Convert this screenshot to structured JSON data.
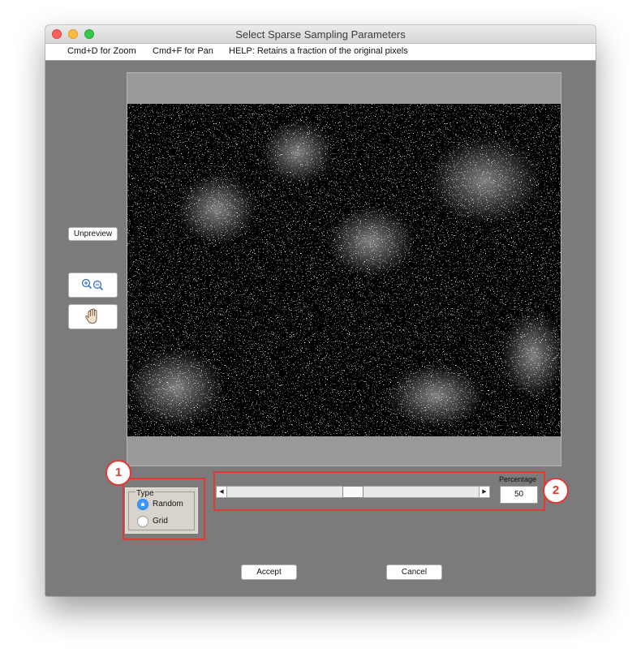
{
  "window": {
    "title": "Select Sparse Sampling Parameters"
  },
  "menubar": {
    "items": [
      {
        "label": "Cmd+D for Zoom"
      },
      {
        "label": "Cmd+F for Pan"
      },
      {
        "label": "HELP:  Retains a fraction of the original pixels"
      }
    ]
  },
  "preview_controls": {
    "unpreview_label": "Unpreview",
    "zoom_icon": "zoom-in-out-icon",
    "pan_icon": "hand-pan-icon"
  },
  "type_panel": {
    "legend": "Type",
    "options": [
      {
        "label": "Random",
        "selected": true
      },
      {
        "label": "Grid",
        "selected": false
      }
    ]
  },
  "percentage": {
    "label": "Percentage",
    "value": "50",
    "slider_fraction": 0.5
  },
  "annotations": [
    {
      "label": "1"
    },
    {
      "label": "2"
    }
  ],
  "buttons": {
    "accept": "Accept",
    "cancel": "Cancel"
  },
  "colors": {
    "annotation": "#e13a32",
    "radio_selected": "#3b99fc",
    "window_bg": "#7b7b7b"
  }
}
